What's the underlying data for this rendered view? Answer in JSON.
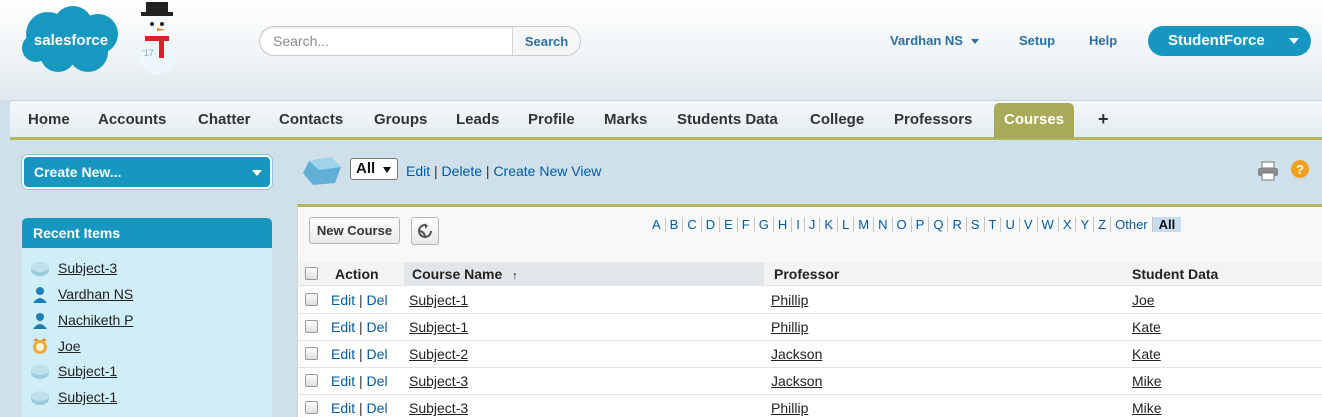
{
  "header": {
    "logo_text": "salesforce",
    "snowman_year": "'17",
    "search": {
      "placeholder": "Search...",
      "button_label": "Search"
    },
    "user_menu_label": "Vardhan NS",
    "setup_label": "Setup",
    "help_label": "Help",
    "app_menu_label": "StudentForce"
  },
  "tabs": [
    {
      "label": "Home"
    },
    {
      "label": "Accounts"
    },
    {
      "label": "Chatter"
    },
    {
      "label": "Contacts"
    },
    {
      "label": "Groups"
    },
    {
      "label": "Leads"
    },
    {
      "label": "Profile"
    },
    {
      "label": "Marks"
    },
    {
      "label": "Students Data"
    },
    {
      "label": "College"
    },
    {
      "label": "Professors"
    },
    {
      "label": "Courses",
      "active": true
    },
    {
      "label": "+"
    }
  ],
  "sidebar": {
    "create_new_label": "Create New...",
    "recent_items_title": "Recent Items",
    "recent_items": [
      {
        "label": "Subject-3",
        "icon": "course-icon"
      },
      {
        "label": "Vardhan NS",
        "icon": "user-icon"
      },
      {
        "label": "Nachiketh P",
        "icon": "user-icon"
      },
      {
        "label": "Joe",
        "icon": "student-icon"
      },
      {
        "label": "Subject-1",
        "icon": "course-icon"
      },
      {
        "label": "Subject-1",
        "icon": "course-icon"
      }
    ]
  },
  "view": {
    "selected": "All",
    "edit_label": "Edit",
    "delete_label": "Delete",
    "create_view_label": "Create New View",
    "separator": "|"
  },
  "list": {
    "new_button_label": "New Course",
    "alphabet": [
      "A",
      "B",
      "C",
      "D",
      "E",
      "F",
      "G",
      "H",
      "I",
      "J",
      "K",
      "L",
      "M",
      "N",
      "O",
      "P",
      "Q",
      "R",
      "S",
      "T",
      "U",
      "V",
      "W",
      "X",
      "Y",
      "Z",
      "Other",
      "All"
    ],
    "alphabet_active": "All",
    "columns": {
      "action": "Action",
      "course_name": "Course Name",
      "sort_indicator": "↑",
      "professor": "Professor",
      "student_data": "Student Data"
    },
    "row_edit_label": "Edit",
    "row_del_label": "Del",
    "rows": [
      {
        "course": "Subject-1",
        "professor": "Phillip",
        "student": "Joe"
      },
      {
        "course": "Subject-1",
        "professor": "Phillip",
        "student": "Kate"
      },
      {
        "course": "Subject-2",
        "professor": "Jackson",
        "student": "Kate"
      },
      {
        "course": "Subject-3",
        "professor": "Jackson",
        "student": "Mike"
      },
      {
        "course": "Subject-3",
        "professor": "Phillip",
        "student": "Mike"
      }
    ]
  },
  "colors": {
    "brand_blue": "#1797c0",
    "active_tab": "#a9a95a",
    "link": "#015ba7"
  }
}
